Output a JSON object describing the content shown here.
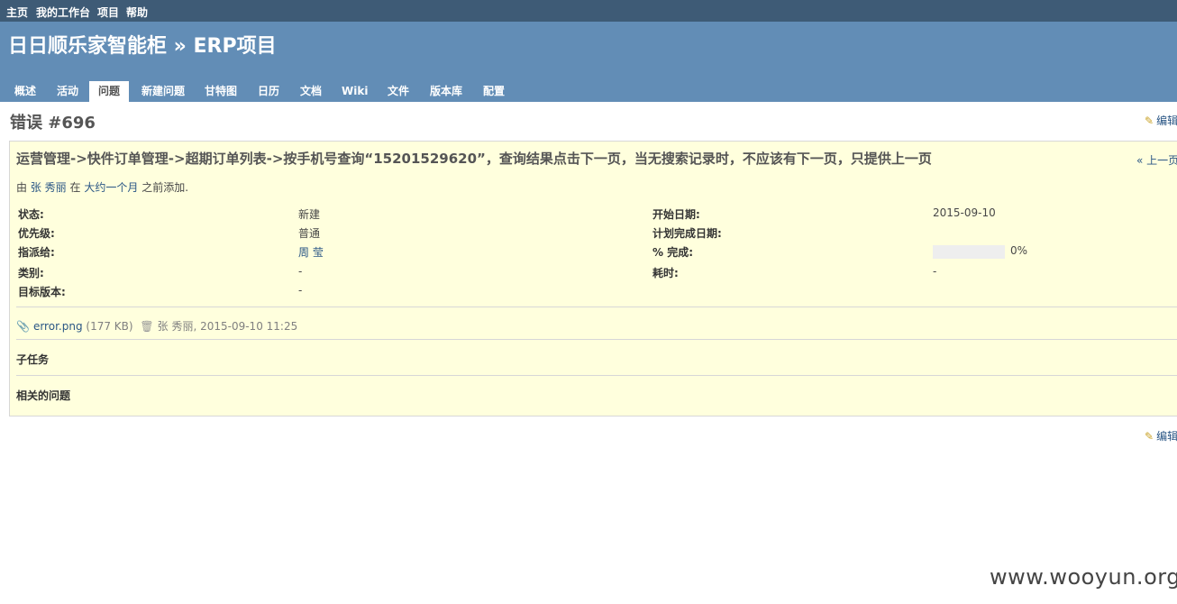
{
  "top_menu": [
    "主页",
    "我的工作台",
    "项目",
    "帮助"
  ],
  "header": {
    "title": "日日顺乐家智能柜 » ERP项目",
    "tabs": [
      "概述",
      "活动",
      "问题",
      "新建问题",
      "甘特图",
      "日历",
      "文档",
      "Wiki",
      "文件",
      "版本库",
      "配置"
    ],
    "selected_tab": "问题"
  },
  "issue": {
    "title": "错误 #696",
    "edit_label": "编辑",
    "subject": "运营管理->快件订单管理->超期订单列表->按手机号查询“15201529620”，查询结果点击下一页，当无搜索记录时，不应该有下一页，只提供上一页",
    "prev_link": "« 上一页",
    "author": {
      "prefix": "由",
      "name": "张 秀丽",
      "middle": "在",
      "time_ago": "大约一个月",
      "suffix": "之前添加."
    },
    "attributes_left": [
      {
        "label": "状态:",
        "value": "新建"
      },
      {
        "label": "优先级:",
        "value": "普通"
      },
      {
        "label": "指派给:",
        "value": "周 莹"
      },
      {
        "label": "类别:",
        "value": "-"
      },
      {
        "label": "目标版本:",
        "value": "-"
      }
    ],
    "attributes_right": [
      {
        "label": "开始日期:",
        "value": "2015-09-10"
      },
      {
        "label": "计划完成日期:",
        "value": ""
      },
      {
        "label": "% 完成:",
        "value": "0%"
      },
      {
        "label": "耗时:",
        "value": "-"
      }
    ],
    "done_ratio": 0,
    "attachment": {
      "file_name": "error.png",
      "size": "(177 KB)",
      "author_date": "张 秀丽, 2015-09-10 11:25"
    },
    "subtasks_label": "子任务",
    "relations_label": "相关的问题"
  },
  "watermark": "www.wooyun.org",
  "colors": {
    "top_menu_bg": "#3e5b76",
    "header_bg": "#628db6",
    "issue_bg": "#ffffdd",
    "link": "#2a5685"
  }
}
